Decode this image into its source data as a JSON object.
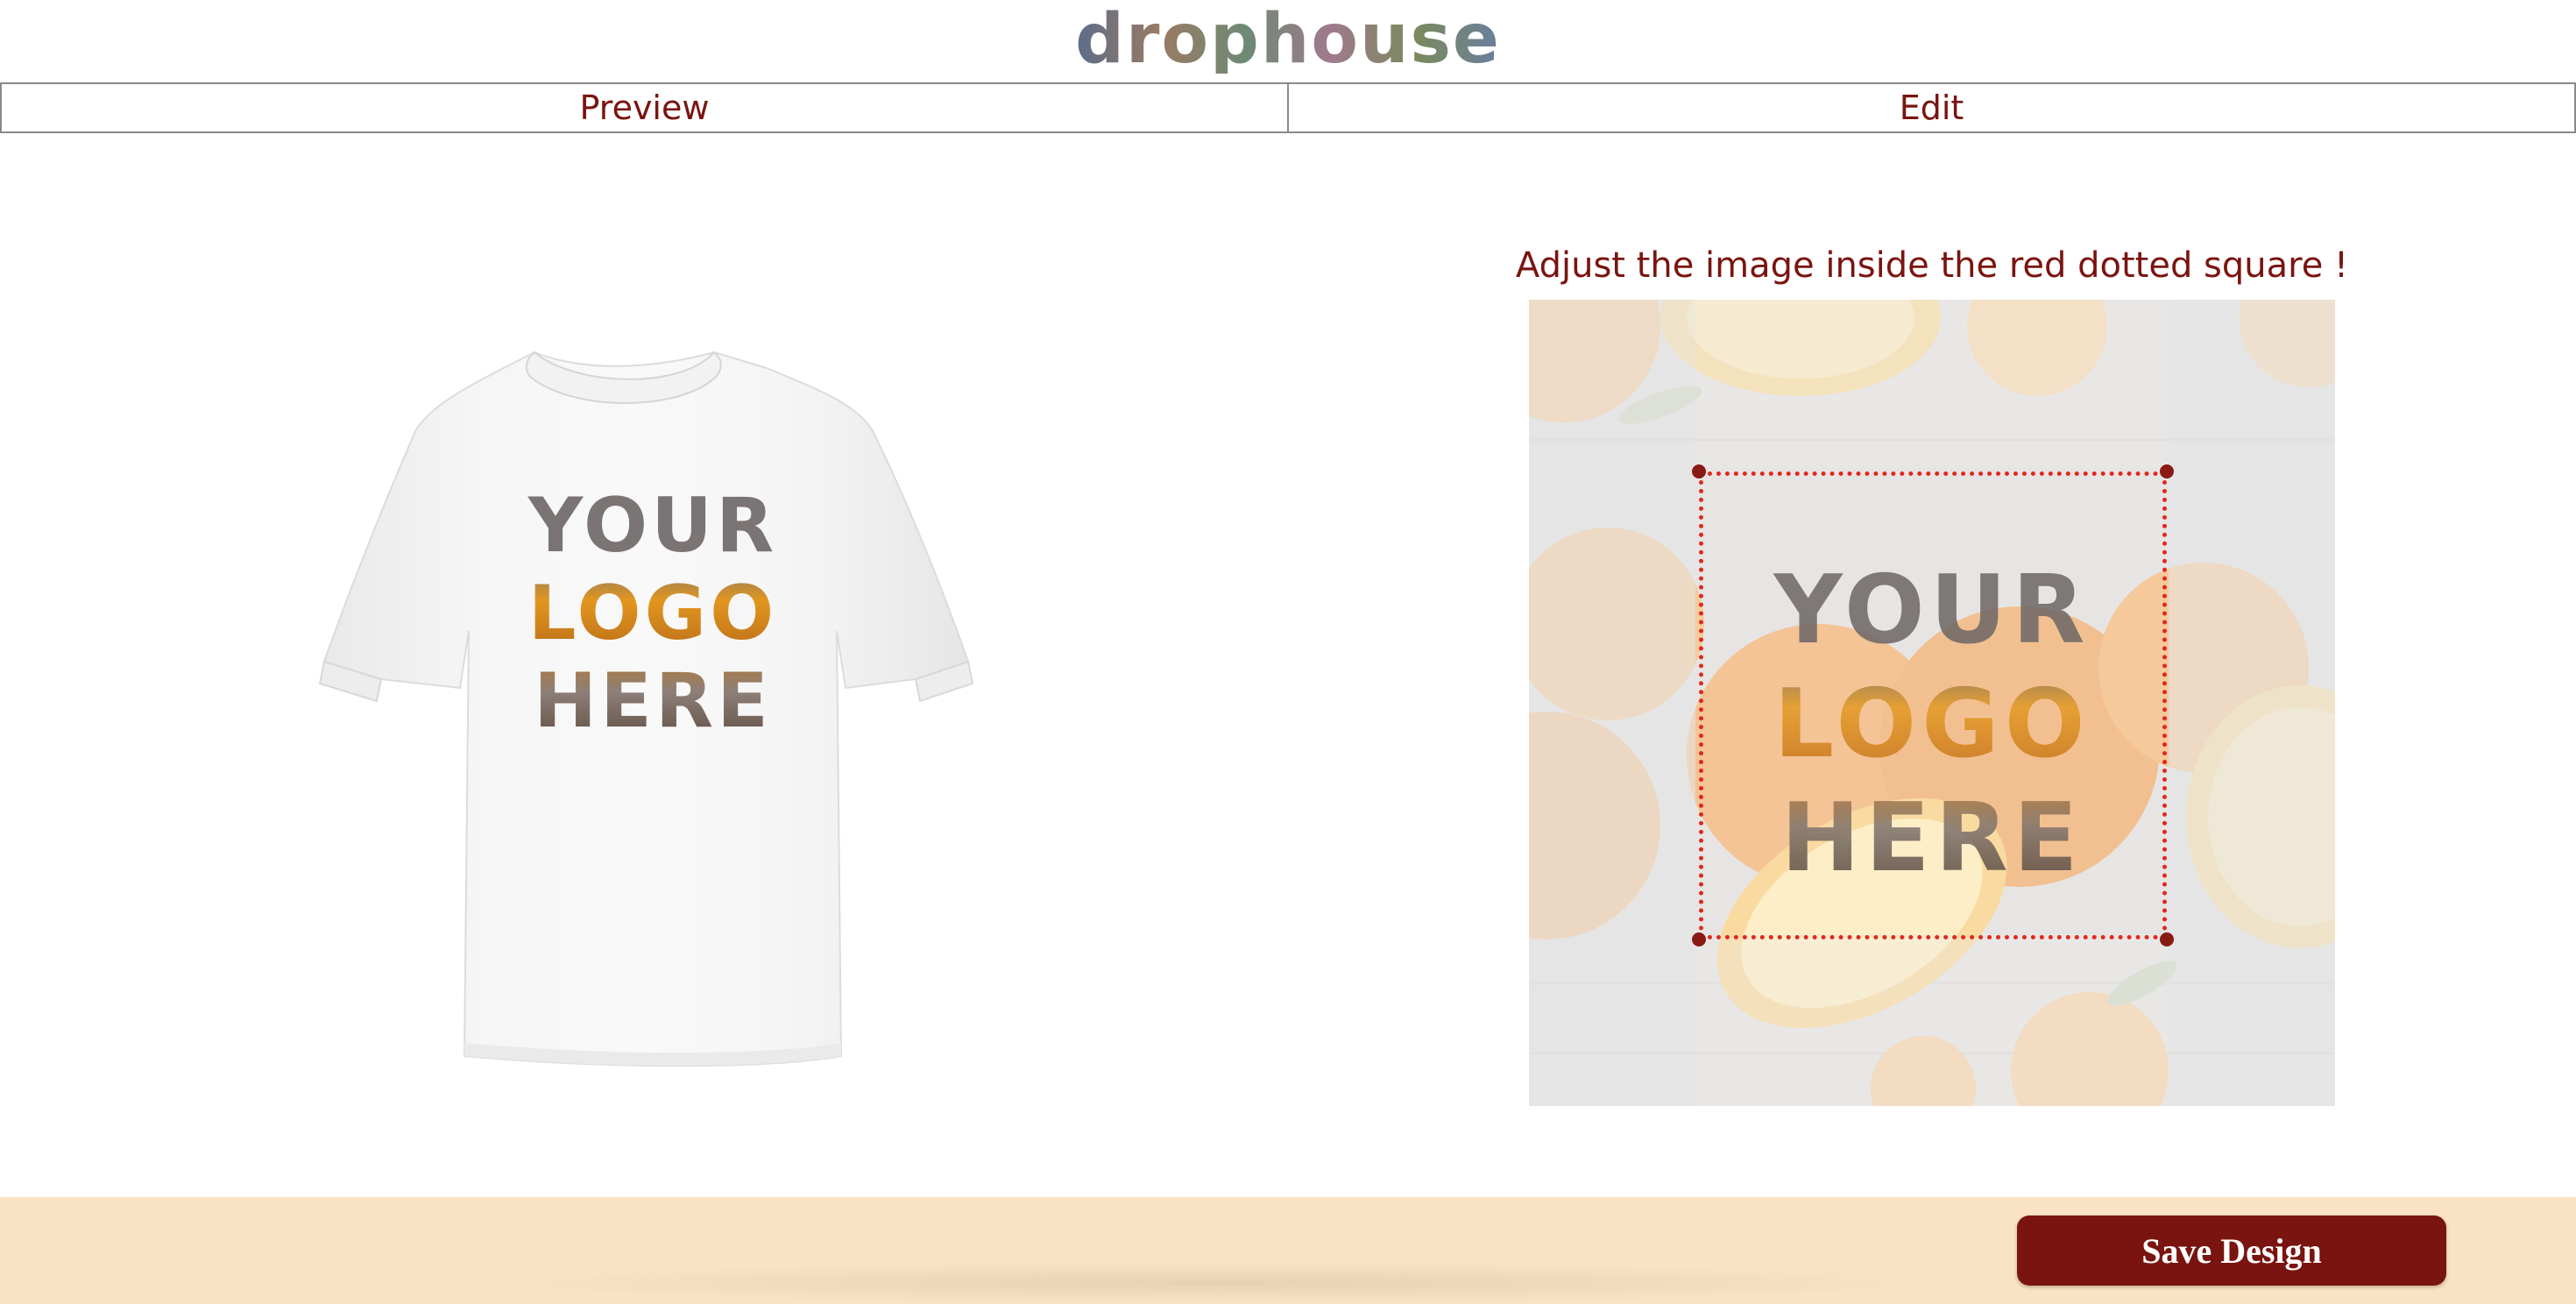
{
  "brand": {
    "name": "drophouse"
  },
  "tabs": [
    {
      "label": "Preview"
    },
    {
      "label": "Edit"
    }
  ],
  "preview": {
    "shirt_text": [
      "YOUR",
      "LOGO",
      "HERE"
    ]
  },
  "editor": {
    "instruction": "Adjust the image inside the red dotted square !",
    "image_text": [
      "YOUR",
      "LOGO",
      "HERE"
    ]
  },
  "footer": {
    "save_label": "Save Design"
  },
  "colors": {
    "accent": "#7a1410",
    "footer_bg": "#f9e3c4",
    "crop_border": "#e0281e"
  }
}
